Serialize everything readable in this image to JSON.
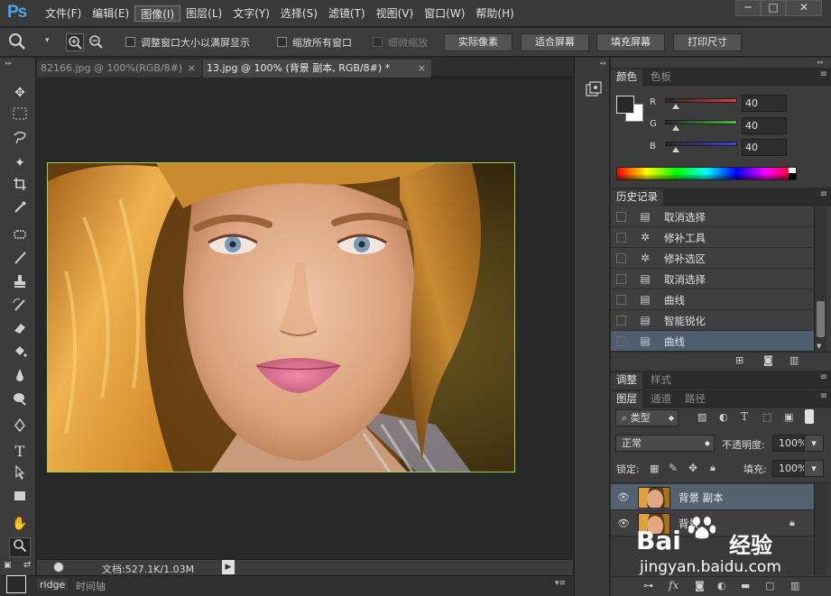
{
  "app": {
    "logo": "Ps"
  },
  "menu": [
    "文件(F)",
    "编辑(E)",
    "图像(I)",
    "图层(L)",
    "文字(Y)",
    "选择(S)",
    "滤镜(T)",
    "视图(V)",
    "窗口(W)",
    "帮助(H)"
  ],
  "window_controls": {
    "minimize": "─",
    "maximize": "□",
    "close": "✕"
  },
  "options": {
    "resize_windows_label": "调整窗口大小以满屏显示",
    "zoom_all_label": "缩放所有窗口",
    "scrubby_zoom_label": "细微缩放",
    "actual_pixels": "实际像素",
    "fit_screen": "适合屏幕",
    "fill_screen": "填充屏幕",
    "print_size": "打印尺寸"
  },
  "doc_tabs": [
    {
      "label": "82166.jpg @ 100%(RGB/8#)",
      "close": "×"
    },
    {
      "label": "13.jpg @ 100% (背景 副本, RGB/8#) *",
      "close": "×"
    }
  ],
  "status": {
    "doc_info": "文档:527.1K/1.03M"
  },
  "bottom_tabs": [
    "ridge",
    "时间轴"
  ],
  "color_panel": {
    "tabs": [
      "颜色",
      "色板"
    ],
    "channels": [
      {
        "label": "R",
        "value": "40",
        "color": "#e04040"
      },
      {
        "label": "G",
        "value": "40",
        "color": "#40c040"
      },
      {
        "label": "B",
        "value": "40",
        "color": "#4040e0"
      }
    ],
    "foreground": "#282828",
    "background": "#ffffff"
  },
  "history_panel": {
    "title": "历史记录",
    "items": [
      {
        "label": "取消选择",
        "icon": "doc-icon"
      },
      {
        "label": "修补工具",
        "icon": "patch-icon"
      },
      {
        "label": "修补选区",
        "icon": "patch-icon"
      },
      {
        "label": "取消选择",
        "icon": "doc-icon"
      },
      {
        "label": "曲线",
        "icon": "doc-icon"
      },
      {
        "label": "智能锐化",
        "icon": "doc-icon"
      },
      {
        "label": "曲线",
        "icon": "doc-icon"
      }
    ],
    "selected_index": 6
  },
  "adjust_tabs": [
    "调整",
    "样式"
  ],
  "layers_panel": {
    "tabs": [
      "图层",
      "通道",
      "路径"
    ],
    "filter_label": "类型",
    "blend_mode": "正常",
    "opacity_label": "不透明度:",
    "opacity": "100%",
    "lock_label": "锁定:",
    "fill_label": "填充:",
    "fill": "100%",
    "layers": [
      {
        "name": "背景 副本",
        "selected": true
      },
      {
        "name": "背景",
        "selected": false,
        "locked": true
      }
    ],
    "footer_icons": [
      "link-icon",
      "fx-icon",
      "mask-icon",
      "adjustment-icon",
      "folder-icon",
      "new-layer-icon",
      "trash-icon"
    ]
  },
  "watermark": {
    "brand": "Bai",
    "brand2": "经验",
    "url": "jingyan.baidu.com"
  }
}
